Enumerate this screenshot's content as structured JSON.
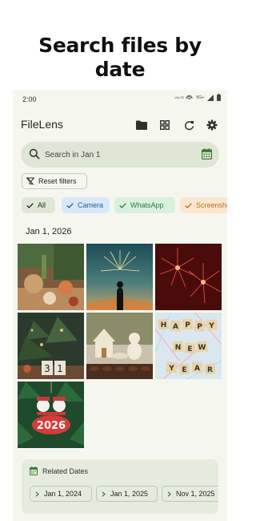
{
  "promo": {
    "headline_line1": "Search files by",
    "headline_line2": "date"
  },
  "status_bar": {
    "time": "2:00",
    "volte": "VoLTE",
    "network": "5G+"
  },
  "app_bar": {
    "title": "FileLens"
  },
  "search": {
    "placeholder": "Search in Jan 1"
  },
  "reset_filters": {
    "label": "Reset filters"
  },
  "filter_chips": [
    {
      "label": "All",
      "bg": "#dfe6d6",
      "fg": "#1e281e"
    },
    {
      "label": "Camera",
      "bg": "#d9e8f8",
      "fg": "#2b5d9a"
    },
    {
      "label": "WhatsApp",
      "bg": "#d8f0dc",
      "fg": "#2f7a3e"
    },
    {
      "label": "Screenshots",
      "bg": "#fbe6cf",
      "fg": "#b5701f"
    }
  ],
  "date_header": "Jan 1, 2026",
  "photos": [
    {
      "description": "festive-table-photo"
    },
    {
      "description": "fireworks-crowd-photo"
    },
    {
      "description": "red-fireworks-photo"
    },
    {
      "description": "christmas-tree-calendar-photo"
    },
    {
      "description": "gingerbread-house-photo"
    },
    {
      "description": "happy-new-year-tiles-photo"
    },
    {
      "description": "snowman-2026-ornament-photo"
    }
  ],
  "related_dates": {
    "title": "Related Dates",
    "chips": [
      "Jan 1, 2024",
      "Jan 1, 2025",
      "Nov 1, 2025"
    ]
  },
  "colors": {
    "accent_green": "#3b7a2e",
    "surface": "#f5f7ef"
  }
}
